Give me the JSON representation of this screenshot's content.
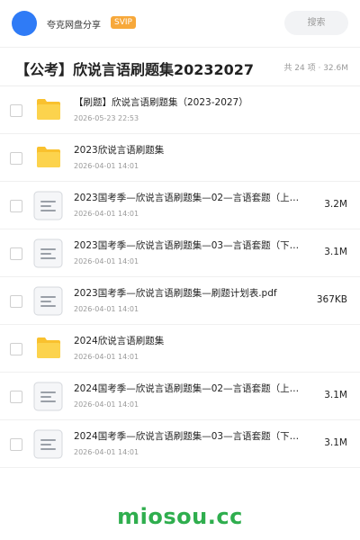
{
  "header": {
    "app_name": "夸克网盘分享",
    "badge": "SVIP",
    "search_placeholder": "搜索"
  },
  "folder": {
    "title": "【公考】欣说言语刷题集20232027",
    "meta": "共 24 项 · 32.6M"
  },
  "files": [
    {
      "type": "folder",
      "name": "【刷题】欣说言语刷题集（2023-2027）",
      "date": "2026-05-23 22:53",
      "size": ""
    },
    {
      "type": "folder",
      "name": "2023欣说言语刷题集",
      "date": "2026-04-01 14:01",
      "size": ""
    },
    {
      "type": "doc",
      "name": "2023国考季—欣说言语刷题集—02—言语套题（上…",
      "date": "2026-04-01 14:01",
      "size": "3.2M"
    },
    {
      "type": "doc",
      "name": "2023国考季—欣说言语刷题集—03—言语套题（下…",
      "date": "2026-04-01 14:01",
      "size": "3.1M"
    },
    {
      "type": "doc",
      "name": "2023国考季—欣说言语刷题集—刷题计划表.pdf",
      "date": "2026-04-01 14:01",
      "size": "367KB"
    },
    {
      "type": "folder",
      "name": "2024欣说言语刷题集",
      "date": "2026-04-01 14:01",
      "size": ""
    },
    {
      "type": "doc",
      "name": "2024国考季—欣说言语刷题集—02—言语套题（上…",
      "date": "2026-04-01 14:01",
      "size": "3.1M"
    },
    {
      "type": "doc",
      "name": "2024国考季—欣说言语刷题集—03—言语套题（下…",
      "date": "2026-04-01 14:01",
      "size": "3.1M"
    }
  ],
  "watermark": "miosou.cc",
  "colors": {
    "avatar": "#2f7bf6",
    "svip_badge": "#f7a83a",
    "folder": "#f9c12e",
    "watermark": "#2fae4e"
  },
  "icons": {
    "folder": "folder-icon",
    "doc": "document-icon"
  }
}
